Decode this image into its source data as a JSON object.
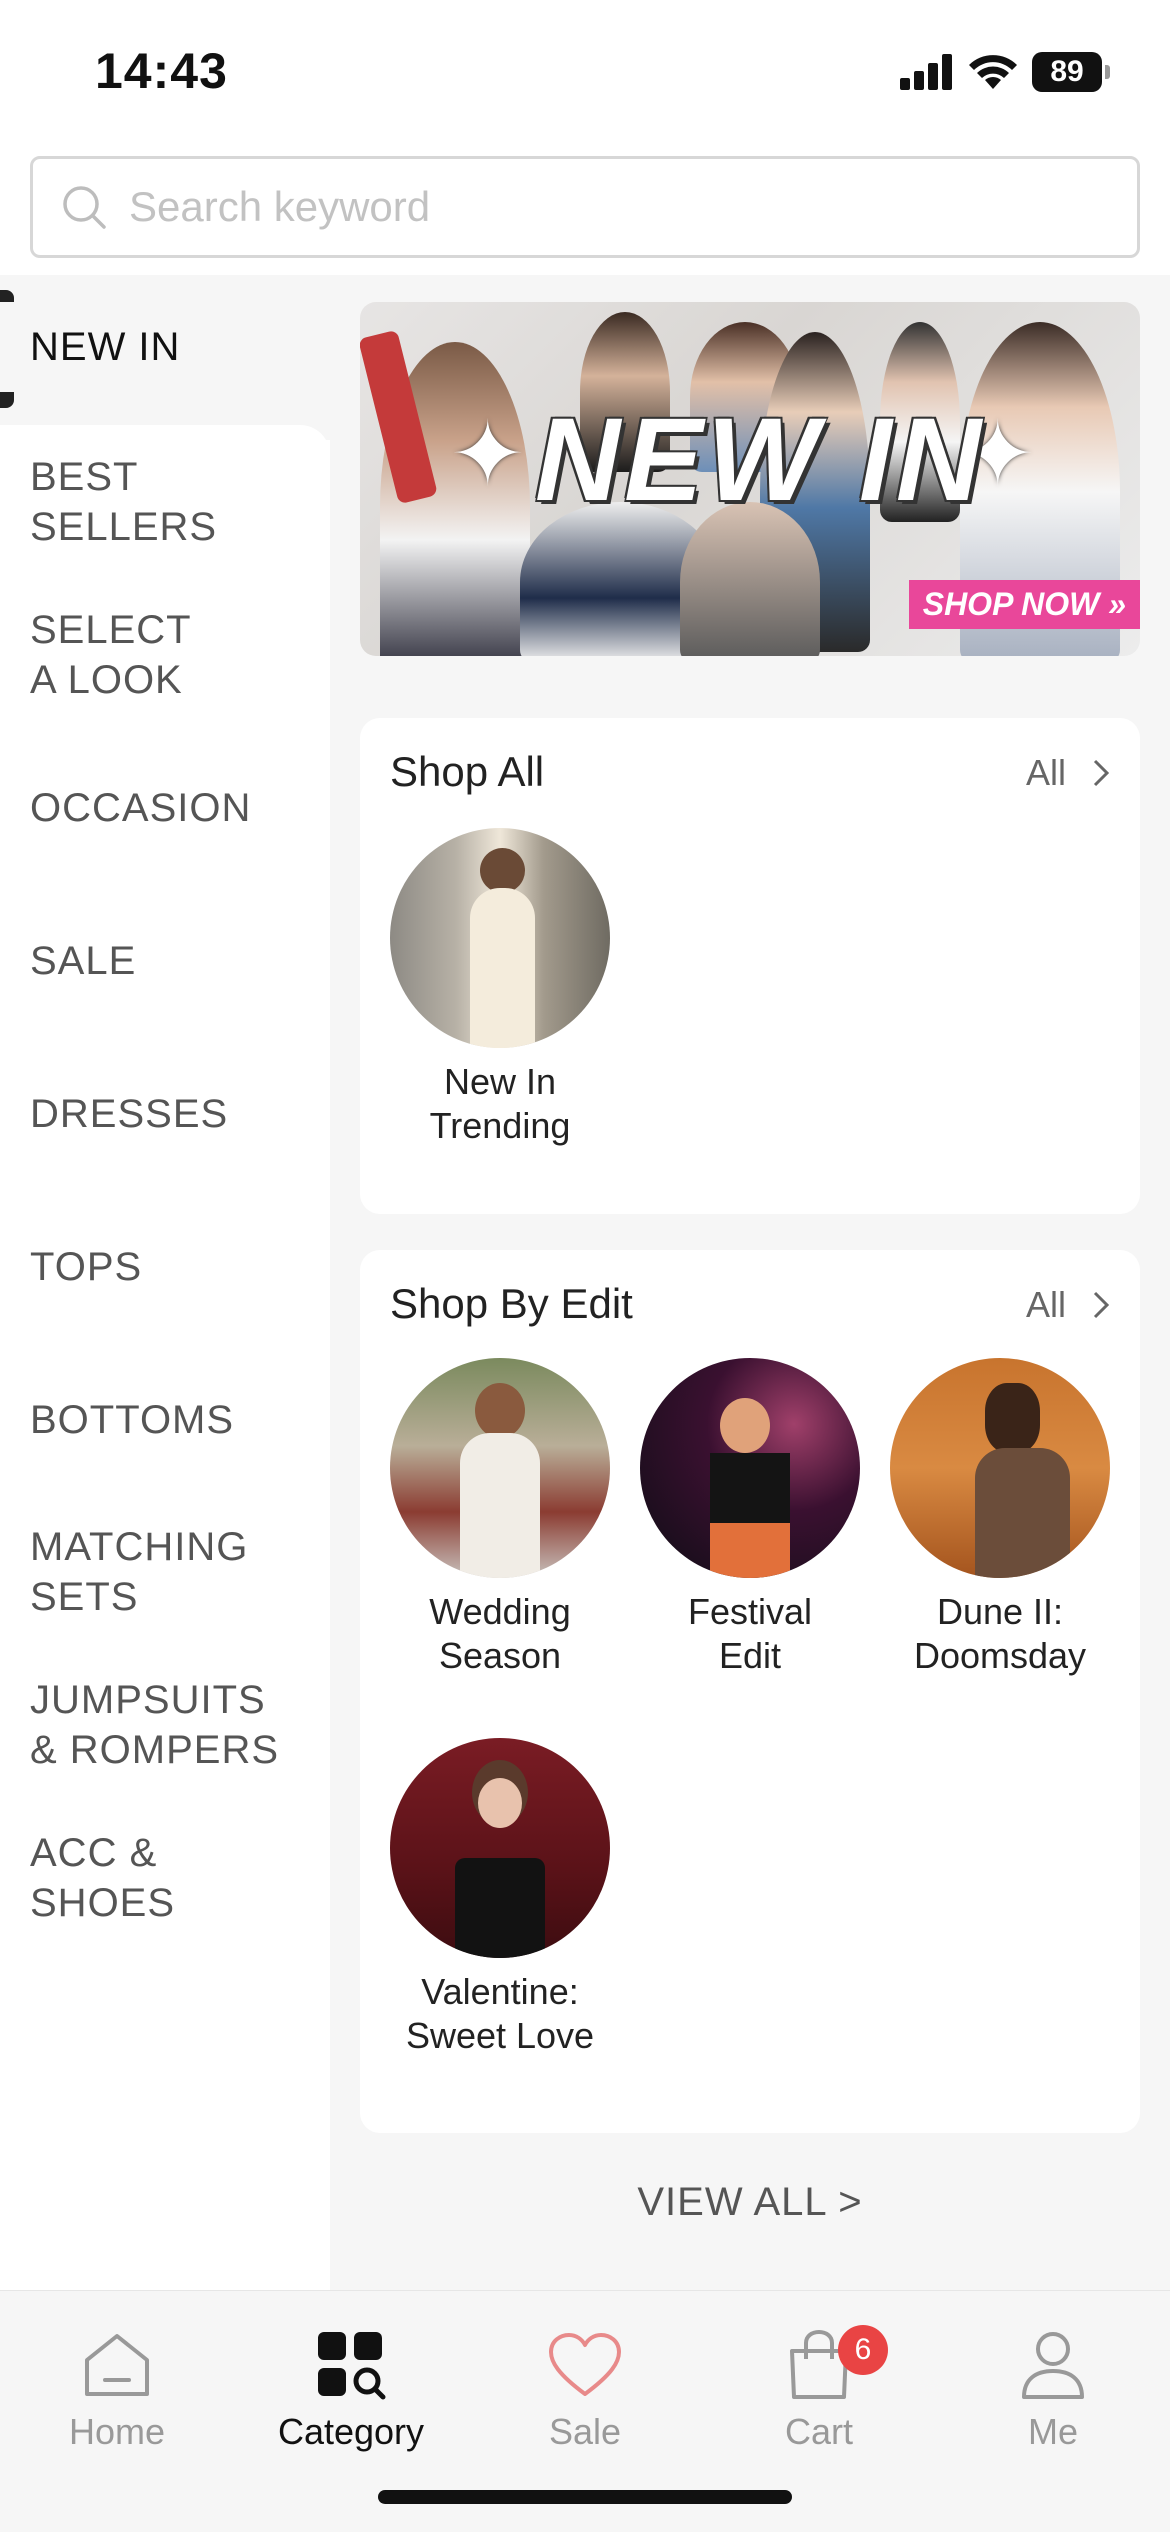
{
  "status": {
    "time": "14:43",
    "battery": "89"
  },
  "search": {
    "placeholder": "Search keyword"
  },
  "sidebar": {
    "items": [
      {
        "line1": "NEW IN",
        "line2": ""
      },
      {
        "line1": "BEST",
        "line2": "SELLERS"
      },
      {
        "line1": "SELECT",
        "line2": "A LOOK"
      },
      {
        "line1": "OCCASION",
        "line2": ""
      },
      {
        "line1": "SALE",
        "line2": ""
      },
      {
        "line1": "DRESSES",
        "line2": ""
      },
      {
        "line1": "TOPS",
        "line2": ""
      },
      {
        "line1": "BOTTOMS",
        "line2": ""
      },
      {
        "line1": "MATCHING",
        "line2": "SETS"
      },
      {
        "line1": "JUMPSUITS",
        "line2": "& ROMPERS"
      },
      {
        "line1": "ACC &",
        "line2": "SHOES"
      }
    ]
  },
  "banner": {
    "title": "NEW IN",
    "cta": "SHOP NOW »"
  },
  "shop_all": {
    "title": "Shop All",
    "all_label": "All",
    "tiles": [
      {
        "line1": "New In",
        "line2": "Trending"
      }
    ]
  },
  "shop_by_edit": {
    "title": "Shop By Edit",
    "all_label": "All",
    "tiles": [
      {
        "line1": "Wedding",
        "line2": "Season"
      },
      {
        "line1": "Festival",
        "line2": "Edit"
      },
      {
        "line1": "Dune II:",
        "line2": "Doomsday"
      },
      {
        "line1": "Valentine:",
        "line2": "Sweet Love"
      }
    ]
  },
  "view_all": "VIEW ALL >",
  "tabs": [
    {
      "label": "Home",
      "icon": "home-icon"
    },
    {
      "label": "Category",
      "icon": "category-icon"
    },
    {
      "label": "Sale",
      "icon": "heart-icon"
    },
    {
      "label": "Cart",
      "icon": "cart-icon",
      "badge": "6"
    },
    {
      "label": "Me",
      "icon": "person-icon"
    }
  ],
  "colors": {
    "accent": "#e9479a",
    "badge": "#e94444",
    "sale_heart": "#e88a8a"
  }
}
